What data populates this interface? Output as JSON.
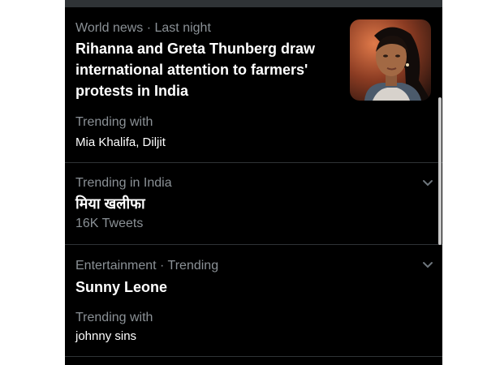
{
  "trends": [
    {
      "meta": "World news · Last night",
      "headline_lines": [
        "Rihanna and Greta Thunberg draw",
        "international attention to farmers'",
        "protests in India"
      ],
      "with_label": "Trending with",
      "with_value": "Mia Khalifa, Diljit",
      "thumbnail": "rihanna-portrait-photo"
    },
    {
      "meta": "Trending in India",
      "title": "मिया खलीफा",
      "count": "16K Tweets",
      "icon": "chevron-down-icon"
    },
    {
      "meta": "Entertainment · Trending",
      "title": "Sunny Leone",
      "with_label": "Trending with",
      "with_value": "johnny sins",
      "icon": "chevron-down-icon"
    }
  ],
  "colors": {
    "background": "#000000",
    "secondary_text": "#8b9196",
    "primary_text": "#ffffff",
    "divider": "#2f3336"
  }
}
